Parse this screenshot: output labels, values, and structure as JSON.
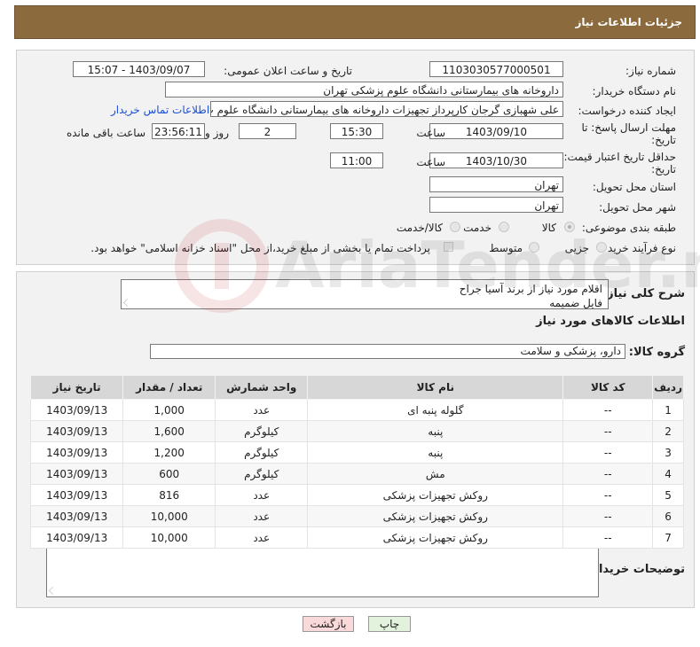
{
  "header": {
    "title": "جزئیات اطلاعات نیاز"
  },
  "form": {
    "need_number_label": "شماره نیاز:",
    "need_number": "1103030577000501",
    "announce_label": "تاریخ و ساعت اعلان عمومی:",
    "announce_value": "1403/09/07 - 15:07",
    "buyer_org_label": "نام دستگاه خریدار:",
    "buyer_org": "داروخانه های بیمارستانی دانشگاه علوم پزشکی تهران",
    "creator_label": "ایجاد کننده درخواست:",
    "creator": "علی شهبازی گرجان کارپرداز تجهیزات داروخانه های بیمارستانی دانشگاه علوم پ",
    "contact_link": "اطلاعات تماس خریدار",
    "deadline_label": "مهلت ارسال پاسخ: تا",
    "deadline_label2": "تاریخ:",
    "deadline_date": "1403/09/10",
    "time_label": "ساعت",
    "deadline_time": "15:30",
    "days_value": "2",
    "days_label": "روز و",
    "remaining_time": "23:56:11",
    "remaining_label": "ساعت باقی مانده",
    "validity_label": "حداقل تاریخ اعتبار قیمت: تا",
    "validity_label2": "تاریخ:",
    "validity_date": "1403/10/30",
    "validity_time_label": "ساعت",
    "validity_time": "11:00",
    "province_label": "استان محل تحویل:",
    "province": "تهران",
    "city_label": "شهر محل تحویل:",
    "city": "تهران",
    "category_label": "طبقه بندی موضوعی:",
    "category_options": [
      "کالا",
      "خدمت",
      "کالا/خدمت"
    ],
    "process_label": "نوع فرآیند خرید :",
    "process_options": [
      "جزیی",
      "متوسط"
    ],
    "payment_note": "پرداخت تمام یا بخشی از مبلغ خرید،از محل \"اسناد خزانه اسلامی\" خواهد بود."
  },
  "details": {
    "summary_label": "شرح کلی نیاز:",
    "summary_line1": "اقلام مورد نیاز از برند آسیا جراح",
    "summary_line2": "فایل ضمیمه",
    "items_title": "اطلاعات کالاهای مورد نیاز",
    "group_label": "گروه کالا:",
    "group_value": "دارو، پزشکی و سلامت"
  },
  "table": {
    "headers": [
      "ردیف",
      "کد کالا",
      "نام کالا",
      "واحد شمارش",
      "تعداد / مقدار",
      "تاریخ نیاز"
    ],
    "rows": [
      [
        "1",
        "--",
        "گلوله پنبه ای",
        "عدد",
        "1,000",
        "1403/09/13"
      ],
      [
        "2",
        "--",
        "پنبه",
        "کیلوگرم",
        "1,600",
        "1403/09/13"
      ],
      [
        "3",
        "--",
        "پنبه",
        "کیلوگرم",
        "1,200",
        "1403/09/13"
      ],
      [
        "4",
        "--",
        "مش",
        "کیلوگرم",
        "600",
        "1403/09/13"
      ],
      [
        "5",
        "--",
        "روکش تجهیزات پزشکی",
        "عدد",
        "816",
        "1403/09/13"
      ],
      [
        "6",
        "--",
        "روکش تجهیزات پزشکی",
        "عدد",
        "10,000",
        "1403/09/13"
      ],
      [
        "7",
        "--",
        "روکش تجهیزات پزشکی",
        "عدد",
        "10,000",
        "1403/09/13"
      ]
    ]
  },
  "buyer_notes": {
    "label": "توضیحات خریدار:"
  },
  "buttons": {
    "print": "چاپ",
    "back": "بازگشت"
  },
  "watermark": {
    "text": "AriaTender.net"
  },
  "colors": {
    "header_bg": "#8b6a3d",
    "link": "#1a4fd6",
    "back_btn_bg": "#f9d9d9",
    "print_btn_bg": "#e2f2dc"
  }
}
